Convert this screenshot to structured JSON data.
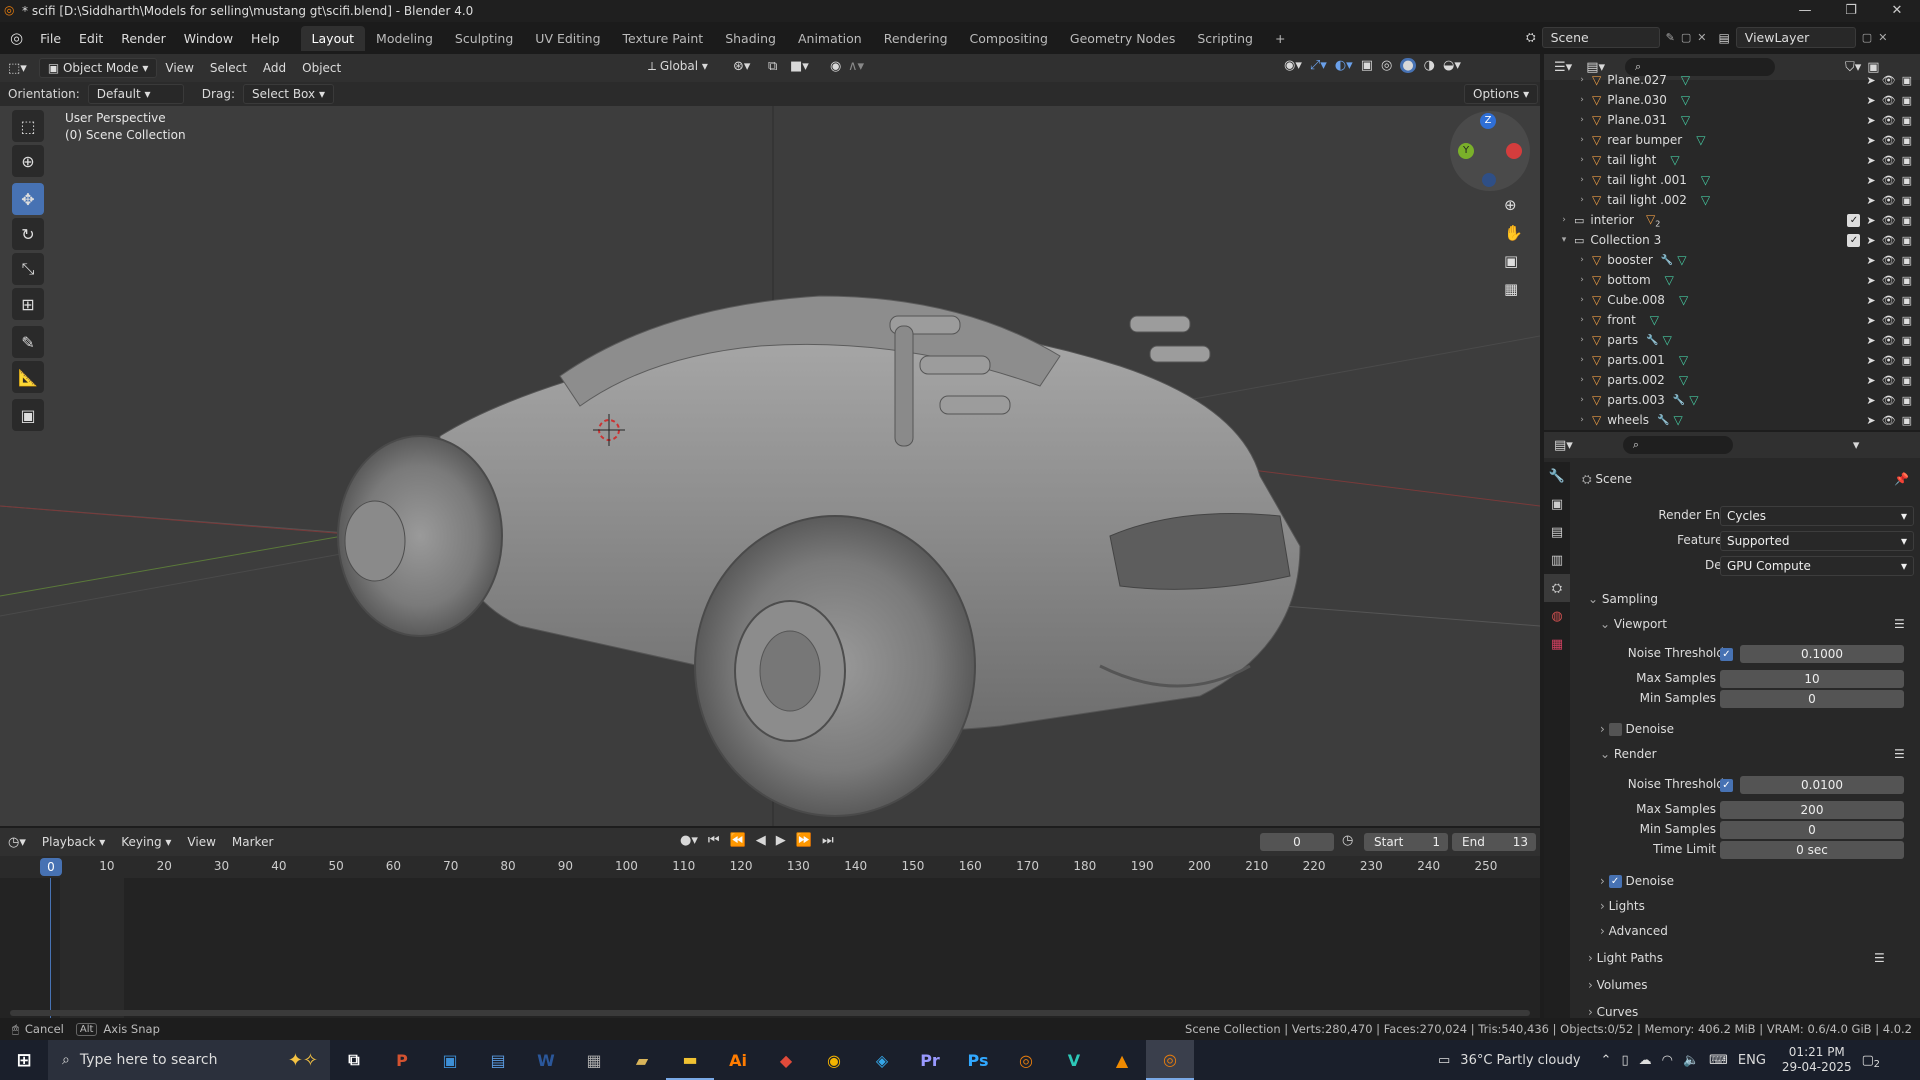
{
  "titlebar": {
    "title": "* scifi [D:\\Siddharth\\Models for selling\\mustang gt\\scifi.blend] - Blender 4.0",
    "min": "—",
    "max": "❐",
    "close": "✕"
  },
  "menu": [
    "File",
    "Edit",
    "Render",
    "Window",
    "Help"
  ],
  "workspaces": [
    "Layout",
    "Modeling",
    "Sculpting",
    "UV Editing",
    "Texture Paint",
    "Shading",
    "Animation",
    "Rendering",
    "Compositing",
    "Geometry Nodes",
    "Scripting"
  ],
  "scene_field": "Scene",
  "viewlayer_field": "ViewLayer",
  "viewport_header": {
    "mode": "Object Mode",
    "menus": [
      "View",
      "Select",
      "Add",
      "Object"
    ],
    "transform": "Global"
  },
  "subheader": {
    "orientation_label": "Orientation:",
    "orientation_value": "Default",
    "drag_label": "Drag:",
    "drag_value": "Select Box",
    "options": "Options"
  },
  "viewport": {
    "perspective": "User Perspective",
    "collection": "(0) Scene Collection",
    "gizmo": {
      "z": "Z",
      "y": "Y"
    }
  },
  "outliner": {
    "rows": [
      {
        "name": "Plane.027",
        "type": "mesh",
        "indent": 2,
        "mod": false
      },
      {
        "name": "Plane.030",
        "type": "mesh",
        "indent": 2,
        "mod": false
      },
      {
        "name": "Plane.031",
        "type": "mesh",
        "indent": 2,
        "mod": false
      },
      {
        "name": "rear bumper",
        "type": "mesh",
        "indent": 2,
        "mod": false
      },
      {
        "name": "tail light",
        "type": "mesh",
        "indent": 2,
        "mod": false
      },
      {
        "name": "tail light .001",
        "type": "mesh",
        "indent": 2,
        "mod": false
      },
      {
        "name": "tail light .002",
        "type": "mesh",
        "indent": 2,
        "mod": false
      },
      {
        "name": "interior",
        "type": "collection",
        "indent": 1,
        "badge": "2"
      },
      {
        "name": "Collection 3",
        "type": "collection",
        "indent": 1,
        "expanded": true
      },
      {
        "name": "booster",
        "type": "mesh",
        "indent": 2,
        "mod": true
      },
      {
        "name": "bottom",
        "type": "mesh",
        "indent": 2,
        "mod": false
      },
      {
        "name": "Cube.008",
        "type": "mesh",
        "indent": 2,
        "mod": false
      },
      {
        "name": "front",
        "type": "mesh",
        "indent": 2,
        "mod": false
      },
      {
        "name": "parts",
        "type": "mesh",
        "indent": 2,
        "mod": true
      },
      {
        "name": "parts.001",
        "type": "mesh",
        "indent": 2,
        "mod": false
      },
      {
        "name": "parts.002",
        "type": "mesh",
        "indent": 2,
        "mod": false
      },
      {
        "name": "parts.003",
        "type": "mesh",
        "indent": 2,
        "mod": true
      },
      {
        "name": "wheels",
        "type": "mesh",
        "indent": 2,
        "mod": true
      }
    ]
  },
  "properties": {
    "context": "Scene",
    "render_engine_label": "Render Engine",
    "render_engine": "Cycles",
    "feature_set_label": "Feature Set",
    "feature_set": "Supported",
    "device_label": "Device",
    "device": "GPU Compute",
    "sampling": "Sampling",
    "viewport": "Viewport",
    "noise_threshold_label": "Noise Threshold",
    "vp_noise_threshold": "0.1000",
    "max_samples_label": "Max Samples",
    "vp_max_samples": "10",
    "min_samples_label": "Min Samples",
    "vp_min_samples": "0",
    "denoise": "Denoise",
    "render": "Render",
    "r_noise_threshold": "0.0100",
    "r_max_samples": "200",
    "r_min_samples": "0",
    "time_limit_label": "Time Limit",
    "time_limit": "0 sec",
    "lights": "Lights",
    "advanced": "Advanced",
    "light_paths": "Light Paths",
    "volumes": "Volumes",
    "curves": "Curves"
  },
  "timeline": {
    "menus": [
      "Playback",
      "Keying",
      "View",
      "Marker"
    ],
    "current_frame": "0",
    "start_label": "Start",
    "start": "1",
    "end_label": "End",
    "end": "13",
    "ticks": [
      "0",
      "10",
      "20",
      "30",
      "40",
      "50",
      "60",
      "70",
      "80",
      "90",
      "100",
      "110",
      "120",
      "130",
      "140",
      "150",
      "160",
      "170",
      "180",
      "190",
      "200",
      "210",
      "220",
      "230",
      "240",
      "250"
    ]
  },
  "statusbar": {
    "cancel": "Cancel",
    "alt": "Alt",
    "axis_snap": "Axis Snap",
    "stats": "Scene Collection | Verts:280,470 | Faces:270,024 | Tris:540,436 | Objects:0/52 | Memory: 406.2 MiB | VRAM: 0.6/4.0 GiB | 4.0.2"
  },
  "taskbar": {
    "search_placeholder": "Type here to search",
    "weather": "36°C  Partly cloudy",
    "lang": "ENG",
    "time": "01:21 PM",
    "date": "29-04-2025",
    "notif": "2",
    "apps": [
      {
        "name": "task-view",
        "label": "⧉",
        "color": "#ffffff"
      },
      {
        "name": "powerpoint",
        "label": "P",
        "color": "#d35230"
      },
      {
        "name": "app-blue",
        "label": "▣",
        "color": "#3d8fd6"
      },
      {
        "name": "app-files",
        "label": "▤",
        "color": "#5a9be0"
      },
      {
        "name": "word",
        "label": "W",
        "color": "#2b579a"
      },
      {
        "name": "app-grey",
        "label": "▦",
        "color": "#aaaaaa"
      },
      {
        "name": "app-folder2",
        "label": "▰",
        "color": "#d9b45a"
      },
      {
        "name": "file-explorer",
        "label": "▬",
        "color": "#f1c232"
      },
      {
        "name": "illustrator",
        "label": "Ai",
        "color": "#ff7c00"
      },
      {
        "name": "app-red",
        "label": "◆",
        "color": "#e04a3a"
      },
      {
        "name": "chrome",
        "label": "◉",
        "color": "#f4b400"
      },
      {
        "name": "m365",
        "label": "◈",
        "color": "#35a6e8"
      },
      {
        "name": "premiere",
        "label": "Pr",
        "color": "#9999ff"
      },
      {
        "name": "photoshop",
        "label": "Ps",
        "color": "#31a8ff"
      },
      {
        "name": "blender",
        "label": "◎",
        "color": "#e87d0d"
      },
      {
        "name": "app-v",
        "label": "V",
        "color": "#2dc8b8"
      },
      {
        "name": "vlc",
        "label": "▲",
        "color": "#f08a00"
      },
      {
        "name": "blender-active",
        "label": "◎",
        "color": "#e87d0d"
      }
    ]
  }
}
